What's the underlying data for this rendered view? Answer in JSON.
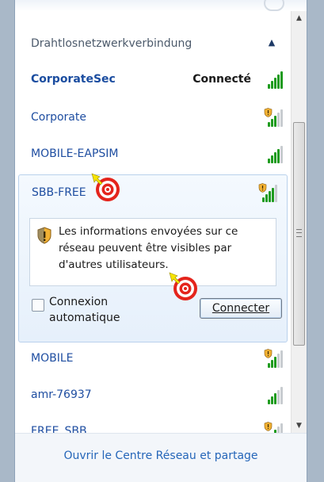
{
  "section": {
    "title": "Drahtlosnetzwerkverbindung",
    "collapse_icon": "chevron-up-icon"
  },
  "networks": [
    {
      "name": "CorporateSec",
      "status": "Connecté",
      "secured": false,
      "signal": 5
    },
    {
      "name": "Corporate",
      "status": "",
      "secured": true,
      "signal": 3
    },
    {
      "name": "MOBILE-EAPSIM",
      "status": "",
      "secured": false,
      "signal": 4
    }
  ],
  "expanded": {
    "name": "SBB-FREE",
    "secured": true,
    "warning_text": "Les informations envoyées sur ce réseau peuvent être visibles par d'autres utilisateurs.",
    "auto_connect_label": "Connexion automatique",
    "auto_connect_checked": false,
    "connect_button": "Connecter"
  },
  "networks_below": [
    {
      "name": "MOBILE",
      "secured": true,
      "signal": 3
    },
    {
      "name": "amr-76937",
      "secured": false,
      "signal": 3
    },
    {
      "name": "FREE_SBB",
      "secured": true,
      "signal": 3
    }
  ],
  "footer": {
    "link": "Ouvrir le Centre Réseau et partage"
  },
  "colors": {
    "link": "#2566b9",
    "signal_green": "#1e9b1e",
    "target_red": "#e4241c",
    "arrow_yellow": "#f7e400"
  }
}
